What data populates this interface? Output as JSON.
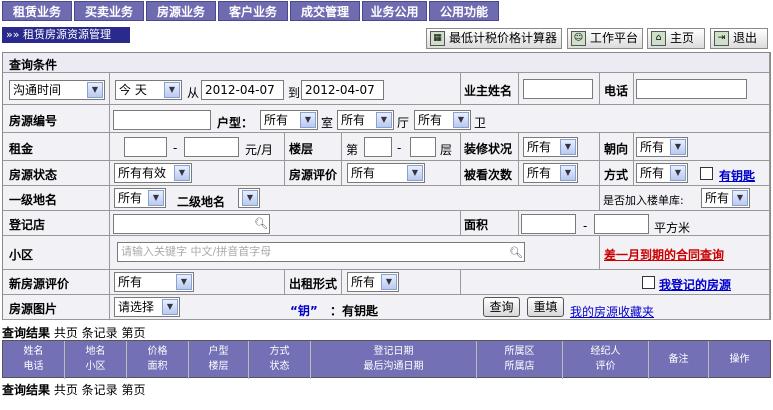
{
  "nav": {
    "tabs": [
      "租赁业务",
      "买卖业务",
      "房源业务",
      "客户业务",
      "成交管理",
      "业务公用",
      "公用功能"
    ]
  },
  "breadcrumb": "»» 租赁房源资源管理",
  "toolbar": {
    "calc": "最低计税价格计算器",
    "workspace": "工作平台",
    "home": "主页",
    "exit": "退出"
  },
  "form": {
    "section_title": "查询条件",
    "comm_time": "沟通时间",
    "period": "今  天",
    "from": "从",
    "date_from": "2012-04-07",
    "to": "到",
    "date_to": "2012-04-07",
    "landlord_label": "业主姓名",
    "phone_label": "电话",
    "house_no_label": "房源编号",
    "layout_label": "户型：",
    "any": "所有",
    "room": "室",
    "hall": "厅",
    "bath": "卫",
    "rent_label": "租金",
    "dash": "-",
    "rent_unit": "元/月",
    "floor_label": "楼层",
    "floor_prefix": "第",
    "floor_suffix": "层",
    "decor_label": "装修状况",
    "orient_label": "朝向",
    "status_label": "房源状态",
    "status_val": "所有有效",
    "rating_label": "房源评价",
    "viewed_label": "被看次数",
    "method_label": "方式",
    "has_key": "有钥匙",
    "area1_label": "一级地名",
    "area2_label": "二级地名",
    "in_list_label": "是否加入楼单库:",
    "store_label": "登记店",
    "size_label": "面积",
    "size_unit": "平方米",
    "community_label": "小区",
    "community_placeholder": "请输入关键字 中文/拼音首字母",
    "expire_link": "差一月到期的合同查询",
    "new_rating_label": "新房源评价",
    "rent_form_label": "出租形式",
    "my_listed": "我登记的房源",
    "photo_label": "房源图片",
    "photo_val": "请选择",
    "key_note_a": "“钥”",
    "key_note_b": "：有钥匙",
    "query_btn": "查询",
    "reset_btn": "重填",
    "fav_link": "我的房源收藏夹"
  },
  "results": {
    "title": "查询结果",
    "summary": "共页 条记录 第页"
  },
  "table": {
    "columns": [
      [
        "姓名",
        "电话"
      ],
      [
        "地名",
        "小区"
      ],
      [
        "价格",
        "面积"
      ],
      [
        "户型",
        "楼层"
      ],
      [
        "方式",
        "状态"
      ],
      [
        "登记日期",
        "最后沟通日期"
      ],
      [
        "所属区",
        "所属店"
      ],
      [
        "经纪人",
        "评价"
      ],
      [
        "备注",
        ""
      ],
      [
        "操作",
        ""
      ]
    ]
  },
  "colors": {
    "nav": "#6e6bb0",
    "header": "#7470b6",
    "crumb": "#2a2a8c",
    "cell": "#f2f1f6",
    "link": "#0000cc",
    "alert": "#cc0000"
  }
}
